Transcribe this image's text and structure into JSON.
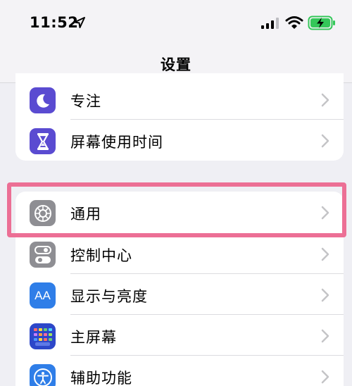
{
  "status_bar": {
    "time": "11:52",
    "icons": [
      "location-arrow-icon",
      "cellular-signal-icon",
      "wifi-icon",
      "battery-charging-icon"
    ]
  },
  "nav": {
    "title": "设置"
  },
  "groups": [
    {
      "items": [
        {
          "label": "专注",
          "icon": "moon-icon",
          "icon_bg": "#5a4bd1"
        },
        {
          "label": "屏幕使用时间",
          "icon": "hourglass-icon",
          "icon_bg": "#5a4bd1"
        }
      ]
    },
    {
      "items": [
        {
          "label": "通用",
          "icon": "gear-icon",
          "icon_bg": "#8e8e93"
        },
        {
          "label": "控制中心",
          "icon": "toggles-icon",
          "icon_bg": "#8e8e93"
        },
        {
          "label": "显示与亮度",
          "icon": "text-size-icon",
          "icon_bg": "#2f7ee8",
          "icon_text": "AA"
        },
        {
          "label": "主屏幕",
          "icon": "home-screen-grid-icon",
          "icon_bg": "#2d47c9"
        },
        {
          "label": "辅助功能",
          "icon": "accessibility-icon",
          "icon_bg": "#2f7ee8"
        }
      ]
    }
  ],
  "highlight": {
    "target": "通用",
    "color": "#ec6f95"
  }
}
